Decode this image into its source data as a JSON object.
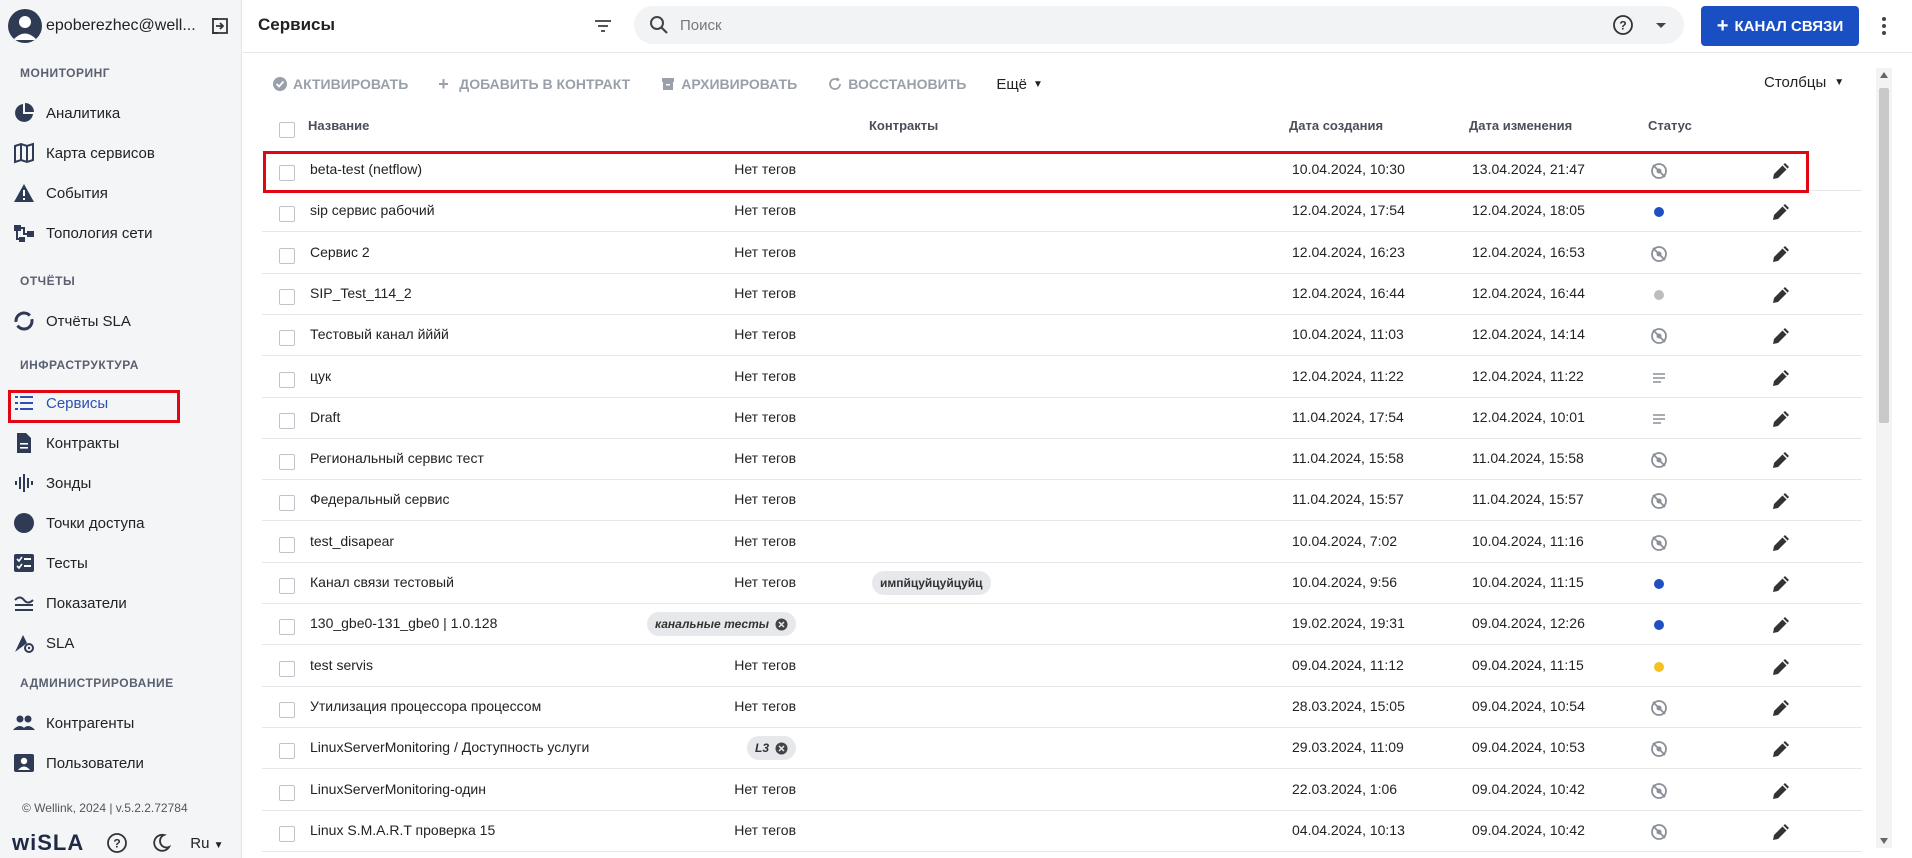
{
  "user": {
    "name": "epoberezhec@well..."
  },
  "sidebar": {
    "sections": [
      {
        "title": "МОНИТОРИНГ",
        "items": [
          {
            "label": "Аналитика",
            "icon": "pie-chart-icon"
          },
          {
            "label": "Карта сервисов",
            "icon": "map-icon"
          },
          {
            "label": "События",
            "icon": "warning-icon"
          },
          {
            "label": "Топология сети",
            "icon": "topology-icon"
          }
        ]
      },
      {
        "title": "ОТЧЁТЫ",
        "items": [
          {
            "label": "Отчёты SLA",
            "icon": "donut-icon"
          }
        ]
      },
      {
        "title": "ИНФРАСТРУКТУРА",
        "items": [
          {
            "label": "Сервисы",
            "icon": "list-icon",
            "active": true
          },
          {
            "label": "Контракты",
            "icon": "document-icon"
          },
          {
            "label": "Зонды",
            "icon": "wave-icon"
          },
          {
            "label": "Точки доступа",
            "icon": "circle-icon"
          },
          {
            "label": "Тесты",
            "icon": "checklist-icon"
          },
          {
            "label": "Показатели",
            "icon": "metrics-icon"
          },
          {
            "label": "SLA",
            "icon": "sla-gear-icon"
          }
        ]
      },
      {
        "title": "АДМИНИСТРИРОВАНИЕ",
        "items": [
          {
            "label": "Контрагенты",
            "icon": "people-icon"
          },
          {
            "label": "Пользователи",
            "icon": "user-card-icon"
          }
        ]
      }
    ],
    "copyright": "© Wellink, 2024 | v.5.2.2.72784",
    "logo": "wiSLA",
    "language": "Ru"
  },
  "header": {
    "title": "Сервисы",
    "search_placeholder": "Поиск",
    "channel_button": "КАНАЛ СВЯЗИ"
  },
  "toolbar": {
    "activate": "АКТИВИРОВАТЬ",
    "add_to_contract": "ДОБАВИТЬ В КОНТРАКТ",
    "archive": "АРХИВИРОВАТЬ",
    "restore": "ВОССТАНОВИТЬ",
    "more": "Ещё",
    "columns": "Столбцы"
  },
  "table": {
    "headers": {
      "name": "Название",
      "contracts": "Контракты",
      "created": "Дата создания",
      "changed": "Дата изменения",
      "status": "Статус"
    },
    "rows": [
      {
        "name": "beta-test (netflow)",
        "tags": "Нет тегов",
        "contract": "",
        "created": "10.04.2024, 10:30",
        "changed": "13.04.2024, 21:47",
        "status": "inactive"
      },
      {
        "name": "sip сервис рабочий",
        "tags": "Нет тегов",
        "contract": "",
        "created": "12.04.2024, 17:54",
        "changed": "12.04.2024, 18:05",
        "status": "active"
      },
      {
        "name": "Сервис 2",
        "tags": "Нет тегов",
        "contract": "",
        "created": "12.04.2024, 16:23",
        "changed": "12.04.2024, 16:53",
        "status": "inactive"
      },
      {
        "name": "SIP_Test_114_2",
        "tags": "Нет тегов",
        "contract": "",
        "created": "12.04.2024, 16:44",
        "changed": "12.04.2024, 16:44",
        "status": "grey"
      },
      {
        "name": "Тестовый канал йййй",
        "tags": "Нет тегов",
        "contract": "",
        "created": "10.04.2024, 11:03",
        "changed": "12.04.2024, 14:14",
        "status": "inactive"
      },
      {
        "name": "цук",
        "tags": "Нет тегов",
        "contract": "",
        "created": "12.04.2024, 11:22",
        "changed": "12.04.2024, 11:22",
        "status": "draft"
      },
      {
        "name": "Draft",
        "tags": "Нет тегов",
        "contract": "",
        "created": "11.04.2024, 17:54",
        "changed": "12.04.2024, 10:01",
        "status": "draft"
      },
      {
        "name": "Региональный сервис тест",
        "tags": "Нет тегов",
        "contract": "",
        "created": "11.04.2024, 15:58",
        "changed": "11.04.2024, 15:58",
        "status": "inactive"
      },
      {
        "name": "Федеральный сервис",
        "tags": "Нет тегов",
        "contract": "",
        "created": "11.04.2024, 15:57",
        "changed": "11.04.2024, 15:57",
        "status": "inactive"
      },
      {
        "name": "test_disapear",
        "tags": "Нет тегов",
        "contract": "",
        "created": "10.04.2024, 7:02",
        "changed": "10.04.2024, 11:16",
        "status": "inactive"
      },
      {
        "name": "Канал связи тестовый",
        "tags": "Нет тегов",
        "contract": "импйцуйцуйцуйц",
        "created": "10.04.2024, 9:56",
        "changed": "10.04.2024, 11:15",
        "status": "active"
      },
      {
        "name": "130_gbe0-131_gbe0 | 1.0.128",
        "tag_chip": "канальные тесты",
        "contract": "",
        "created": "19.02.2024, 19:31",
        "changed": "09.04.2024, 12:26",
        "status": "active"
      },
      {
        "name": "test servis",
        "tags": "Нет тегов",
        "contract": "",
        "created": "09.04.2024, 11:12",
        "changed": "09.04.2024, 11:15",
        "status": "warning"
      },
      {
        "name": "Утилизация процессора процессом",
        "tags": "Нет тегов",
        "contract": "",
        "created": "28.03.2024, 15:05",
        "changed": "09.04.2024, 10:54",
        "status": "inactive"
      },
      {
        "name": "LinuxServerMonitoring / Доступность услуги",
        "tag_chip": "L3",
        "contract": "",
        "created": "29.03.2024, 11:09",
        "changed": "09.04.2024, 10:53",
        "status": "inactive"
      },
      {
        "name": "LinuxServerMonitoring-один",
        "tags": "Нет тегов",
        "contract": "",
        "created": "22.03.2024, 1:06",
        "changed": "09.04.2024, 10:42",
        "status": "inactive"
      },
      {
        "name": "Linux S.M.A.R.T проверка 15",
        "tags": "Нет тегов",
        "contract": "",
        "created": "04.04.2024, 10:13",
        "changed": "09.04.2024, 10:42",
        "status": "inactive"
      }
    ]
  },
  "colors": {
    "accent": "#1a4fc4",
    "status_active": "#1f4fc2",
    "status_grey": "#bdbdbd",
    "status_warning": "#f5c021",
    "highlight": "#e20613"
  }
}
